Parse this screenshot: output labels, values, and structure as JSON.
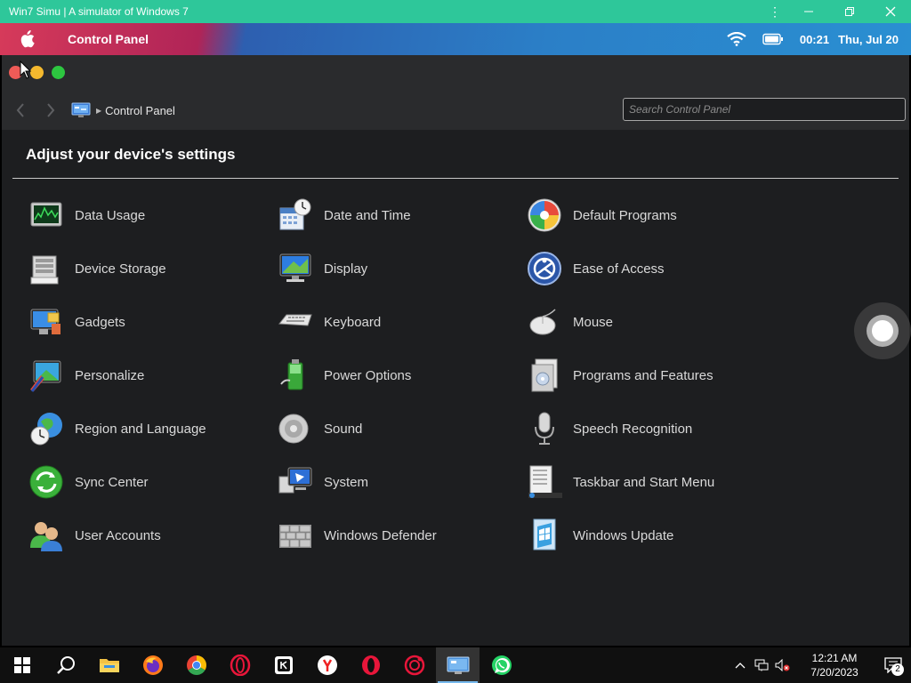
{
  "emulator": {
    "title": "Win7 Simu | A simulator of Windows 7"
  },
  "menubar": {
    "app_title": "Control Panel",
    "time": "00:21",
    "date": "Thu, Jul 20"
  },
  "breadcrumb": {
    "label": "Control Panel"
  },
  "search": {
    "placeholder": "Search Control Panel"
  },
  "heading": "Adjust your device's settings",
  "items": [
    {
      "label": "Data Usage",
      "icon": "data-usage-icon"
    },
    {
      "label": "Date and Time",
      "icon": "date-time-icon"
    },
    {
      "label": "Default Programs",
      "icon": "default-programs-icon"
    },
    {
      "label": "Device Storage",
      "icon": "device-storage-icon"
    },
    {
      "label": "Display",
      "icon": "display-icon"
    },
    {
      "label": "Ease of Access",
      "icon": "ease-of-access-icon"
    },
    {
      "label": "Gadgets",
      "icon": "gadgets-icon"
    },
    {
      "label": "Keyboard",
      "icon": "keyboard-icon"
    },
    {
      "label": "Mouse",
      "icon": "mouse-icon"
    },
    {
      "label": "Personalize",
      "icon": "personalize-icon"
    },
    {
      "label": "Power Options",
      "icon": "power-options-icon"
    },
    {
      "label": "Programs and Features",
      "icon": "programs-features-icon"
    },
    {
      "label": "Region and Language",
      "icon": "region-language-icon"
    },
    {
      "label": "Sound",
      "icon": "sound-icon"
    },
    {
      "label": "Speech Recognition",
      "icon": "speech-recognition-icon"
    },
    {
      "label": "Sync Center",
      "icon": "sync-center-icon"
    },
    {
      "label": "System",
      "icon": "system-icon"
    },
    {
      "label": "Taskbar and Start Menu",
      "icon": "taskbar-start-menu-icon"
    },
    {
      "label": "User Accounts",
      "icon": "user-accounts-icon"
    },
    {
      "label": "Windows Defender",
      "icon": "windows-defender-icon"
    },
    {
      "label": "Windows Update",
      "icon": "windows-update-icon"
    }
  ],
  "taskbar": {
    "apps": [
      "start-icon",
      "search-icon",
      "file-explorer-icon",
      "firefox-icon",
      "chrome-icon",
      "opera-gx-icon",
      "app-icon",
      "yandex-icon",
      "opera-icon",
      "camera-app-icon",
      "win7-simu-icon",
      "whatsapp-icon"
    ],
    "clock_time": "12:21 AM",
    "clock_date": "7/20/2023",
    "notification_count": "2"
  },
  "colors": {
    "emulator_bar": "#2ec79a",
    "window_bg": "#1d1e20",
    "taskbar_bg": "#101010"
  }
}
